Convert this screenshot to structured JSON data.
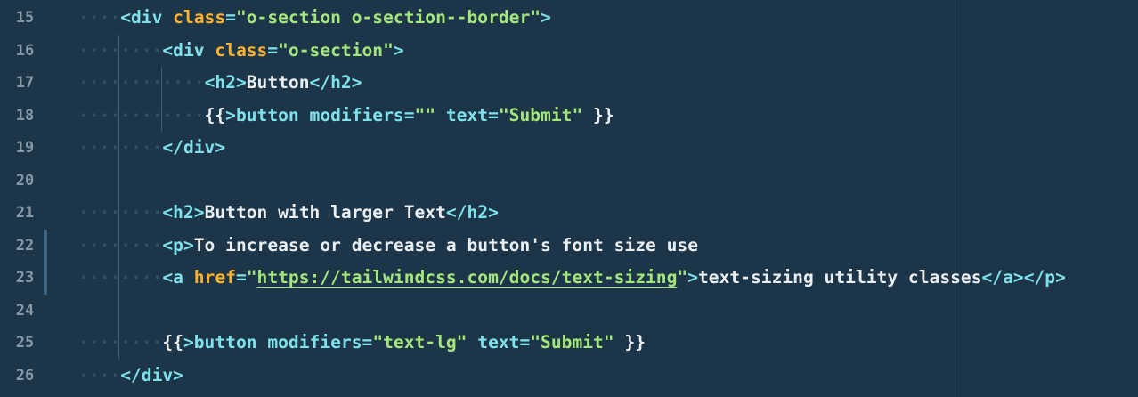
{
  "colors": {
    "background": "#1c3548",
    "line_number": "#8597a5",
    "tag": "#7fe1ea",
    "attribute": "#ffb229",
    "string": "#a4e67b",
    "text": "#e9eef2",
    "whitespace_dots": "#2f5068"
  },
  "lines": [
    {
      "num": "15",
      "indent": 1,
      "tokens": [
        {
          "t": "tag",
          "v": "<div "
        },
        {
          "t": "attr",
          "v": "class"
        },
        {
          "t": "tag",
          "v": "="
        },
        {
          "t": "str",
          "v": "\"o-section o-section--border\""
        },
        {
          "t": "tag",
          "v": ">"
        }
      ]
    },
    {
      "num": "16",
      "indent": 2,
      "tokens": [
        {
          "t": "tag",
          "v": "<div "
        },
        {
          "t": "attr",
          "v": "class"
        },
        {
          "t": "tag",
          "v": "="
        },
        {
          "t": "str",
          "v": "\"o-section\""
        },
        {
          "t": "tag",
          "v": ">"
        }
      ]
    },
    {
      "num": "17",
      "indent": 3,
      "tokens": [
        {
          "t": "tag",
          "v": "<h2>"
        },
        {
          "t": "txt",
          "v": "Button"
        },
        {
          "t": "tag",
          "v": "</h2>"
        }
      ]
    },
    {
      "num": "18",
      "indent": 3,
      "tokens": [
        {
          "t": "txt",
          "v": "{{"
        },
        {
          "t": "tag",
          "v": ">button modifiers="
        },
        {
          "t": "str",
          "v": "\"\""
        },
        {
          "t": "tag",
          "v": " text="
        },
        {
          "t": "str",
          "v": "\"Submit\""
        },
        {
          "t": "tag",
          "v": " "
        },
        {
          "t": "txt",
          "v": "}}"
        }
      ]
    },
    {
      "num": "19",
      "indent": 2,
      "tokens": [
        {
          "t": "tag",
          "v": "</div>"
        }
      ]
    },
    {
      "num": "20",
      "indent": 0,
      "tokens": []
    },
    {
      "num": "21",
      "indent": 2,
      "tokens": [
        {
          "t": "tag",
          "v": "<h2>"
        },
        {
          "t": "txt",
          "v": "Button with larger Text"
        },
        {
          "t": "tag",
          "v": "</h2>"
        }
      ]
    },
    {
      "num": "22",
      "indent": 2,
      "modified": true,
      "tokens": [
        {
          "t": "tag",
          "v": "<p>"
        },
        {
          "t": "txt",
          "v": "To increase or decrease a button's font size use"
        }
      ]
    },
    {
      "num": "23",
      "indent": 2,
      "modified": true,
      "tokens": [
        {
          "t": "tag",
          "v": "<a "
        },
        {
          "t": "attr",
          "v": "href"
        },
        {
          "t": "tag",
          "v": "="
        },
        {
          "t": "str",
          "v": "\""
        },
        {
          "t": "url",
          "v": "https://tailwindcss.com/docs/text-sizing"
        },
        {
          "t": "str",
          "v": "\""
        },
        {
          "t": "tag",
          "v": ">"
        },
        {
          "t": "txt",
          "v": "text-sizing utility classes"
        },
        {
          "t": "tag",
          "v": "</a></p>"
        }
      ]
    },
    {
      "num": "24",
      "indent": 0,
      "tokens": []
    },
    {
      "num": "25",
      "indent": 2,
      "tokens": [
        {
          "t": "txt",
          "v": "{{"
        },
        {
          "t": "tag",
          "v": ">button modifiers="
        },
        {
          "t": "str",
          "v": "\"text-lg\""
        },
        {
          "t": "tag",
          "v": " text="
        },
        {
          "t": "str",
          "v": "\"Submit\""
        },
        {
          "t": "tag",
          "v": " "
        },
        {
          "t": "txt",
          "v": "}}"
        }
      ]
    },
    {
      "num": "26",
      "indent": 1,
      "tokens": [
        {
          "t": "tag",
          "v": "</div>"
        }
      ]
    }
  ]
}
